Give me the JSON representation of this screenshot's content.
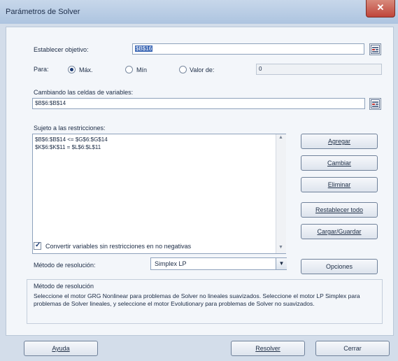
{
  "window": {
    "title": "Parámetros de Solver",
    "close_glyph": "✕"
  },
  "objective": {
    "label": "Establecer objetivo:",
    "value": "$B$16"
  },
  "to": {
    "label": "Para:",
    "options": [
      {
        "label": "Máx.",
        "selected": true
      },
      {
        "label": "Mín",
        "selected": false
      },
      {
        "label": "Valor de:",
        "selected": false
      }
    ],
    "value_of": "0"
  },
  "changing": {
    "label": "Cambiando las celdas de variables:",
    "value": "$B$6:$B$14"
  },
  "constraints": {
    "label": "Sujeto a las restricciones:",
    "items": [
      "$B$6:$B$14 <= $G$6:$G$14",
      "$K$6:$K$11 = $L$6:$L$11"
    ]
  },
  "buttons": {
    "add": "Agregar",
    "change": "Cambiar",
    "delete": "Eliminar",
    "reset_all": "Restablecer todo",
    "load_save": "Cargar/Guardar",
    "options": "Opciones",
    "help": "Ayuda",
    "solve": "Resolver",
    "close": "Cerrar"
  },
  "nonneg": {
    "label": "Convertir variables sin restricciones en no negativas",
    "checked": true
  },
  "method": {
    "label": "Método de resolución:",
    "selected": "Simplex LP"
  },
  "method_group": {
    "title": "Método de resolución",
    "description": "Seleccione el motor GRG Nonlinear para problemas de Solver no lineales suavizados. Seleccione el motor LP Simplex para problemas de Solver lineales, y seleccione el motor Evolutionary para problemas de Solver no suavizados."
  }
}
